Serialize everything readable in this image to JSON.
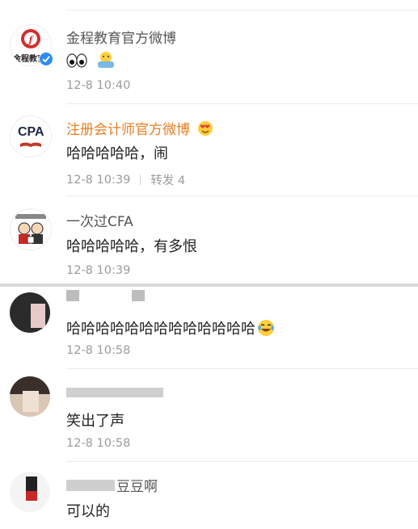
{
  "comments": [
    {
      "username": "金程教育官方微博",
      "avatar_label": "金程教育",
      "text": "",
      "emojis": [
        "eyes-emoji",
        "shrug-emoji"
      ],
      "time": "12-8 10:40"
    },
    {
      "username": "注册会计师官方微博",
      "avatar_label": "CPA",
      "text": "哈哈哈哈哈，闹",
      "time": "12-8 10:39",
      "repost": "转发 4"
    },
    {
      "username": "一次过CFA",
      "text": "哈哈哈哈哈，有多恨",
      "time": "12-8 10:39"
    },
    {
      "username": "",
      "text": "哈哈哈哈哈哈哈哈哈哈哈哈哈",
      "emoji": "laughing-tears-emoji",
      "time": "12-8 10:58"
    },
    {
      "username": "",
      "text": "笑出了声",
      "time": "12-8 10:58"
    },
    {
      "username": "豆豆啊",
      "text": "可以的"
    }
  ],
  "colors": {
    "orange_name": "#e67e22",
    "meta_gray": "#9b9b9b",
    "verified_blue": "#2d8cf0"
  }
}
